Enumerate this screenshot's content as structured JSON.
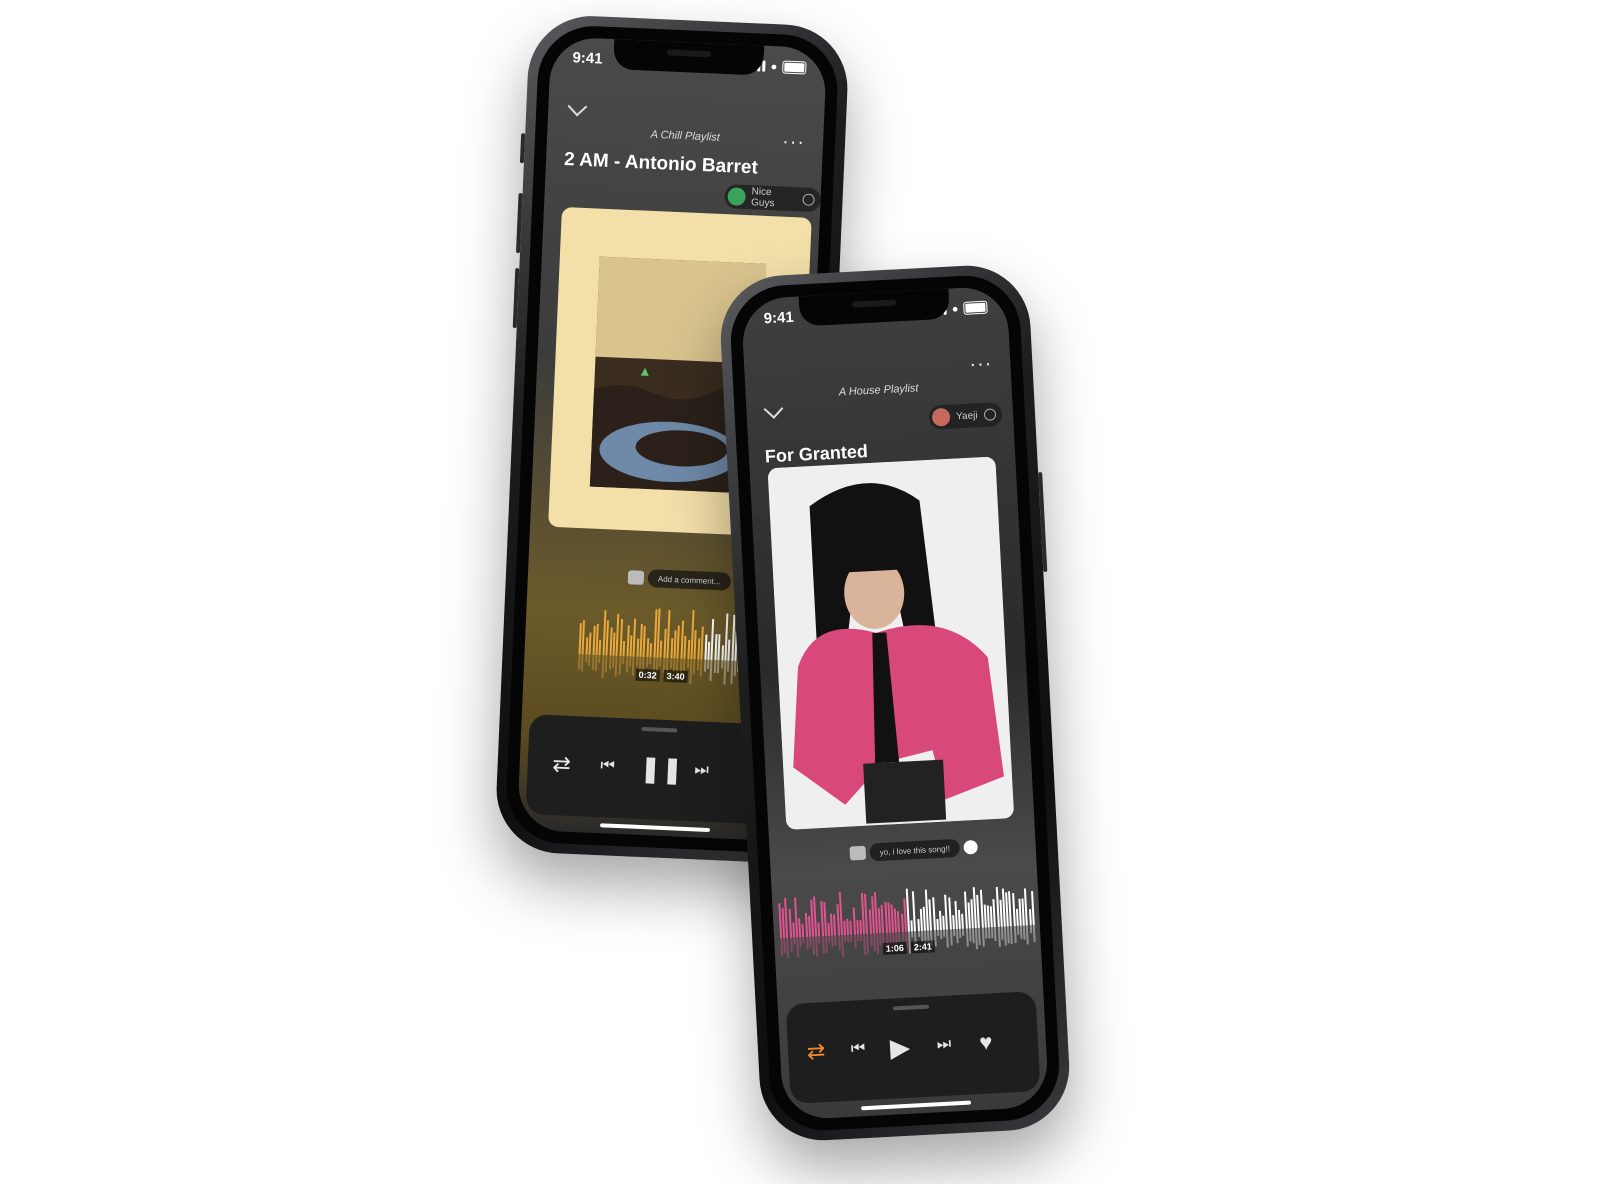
{
  "phone1": {
    "status_time": "9:41",
    "playlist": "A Chill Playlist",
    "song": "2 AM - Antonio Barret",
    "chip_name": "Nice Guys",
    "comment_placeholder": "Add a comment...",
    "elapsed": "0:32",
    "duration": "3:40",
    "accent": "#e8a93a",
    "progress": 0.65
  },
  "phone2": {
    "status_time": "9:41",
    "playlist": "A House Playlist",
    "song": "For Granted",
    "chip_name": "Yaeji",
    "comment_text": "yo, i love this song!!",
    "elapsed": "1:06",
    "duration": "2:41",
    "accent": "#e0538e",
    "progress": 0.5
  },
  "icons": [
    "chevron-down-icon",
    "more-icon",
    "add-user-icon",
    "comment-icon",
    "shuffle-icon",
    "previous-icon",
    "pause-icon",
    "play-icon",
    "next-icon",
    "heart-icon"
  ]
}
